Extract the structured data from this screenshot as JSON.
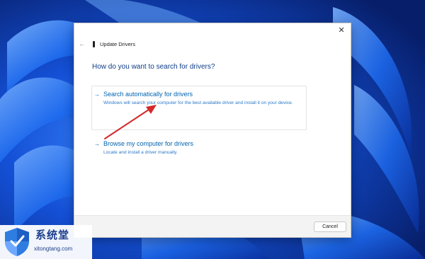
{
  "dialog": {
    "title": "Update Drivers",
    "heading": "How do you want to search for drivers?",
    "close_glyph": "✕",
    "back_glyph": "←",
    "options": [
      {
        "title": "Search automatically for drivers",
        "description": "Windows will search your computer for the best available driver and install it on your device.",
        "arrow_glyph": "→"
      },
      {
        "title": "Browse my computer for drivers",
        "description": "Locate and install a driver manually.",
        "arrow_glyph": "→"
      }
    ],
    "cancel_label": "Cancel"
  },
  "watermark": {
    "chinese": "系统堂",
    "url": "xitongtang.com"
  },
  "icons": {
    "close": "close-icon",
    "back": "back-arrow-icon",
    "drive": "drive-icon",
    "option_arrow": "arrow-right-icon",
    "annotation": "red-arrow-annotation",
    "shield": "shield-logo"
  },
  "colors": {
    "accent": "#0063b1",
    "heading": "#0f3d87",
    "annotation": "#d42a2a",
    "wallpaper_base": "#0a3fae",
    "wallpaper_bloom": "#1e6cf0"
  }
}
